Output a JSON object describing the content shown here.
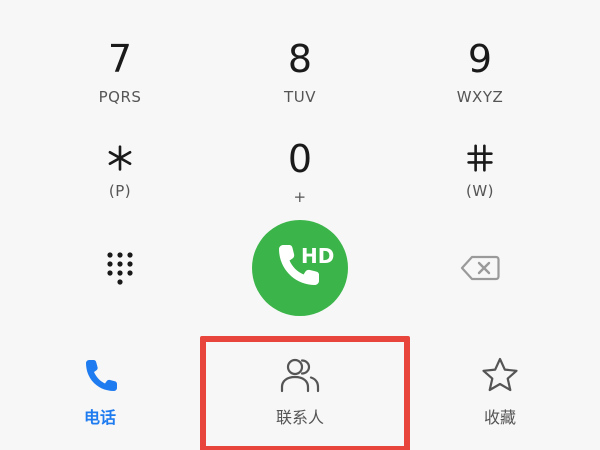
{
  "keypad": {
    "k7": {
      "digit": "7",
      "letters": "PQRS"
    },
    "k8": {
      "digit": "8",
      "letters": "TUV"
    },
    "k9": {
      "digit": "9",
      "letters": "WXYZ"
    },
    "kstar": {
      "letters": "(P)"
    },
    "k0": {
      "digit": "0",
      "letters": "+"
    },
    "khash": {
      "letters": "(W)"
    }
  },
  "call": {
    "badge": "HD",
    "color": "#3bb54a"
  },
  "tabs": {
    "phone": {
      "label": "电话",
      "icon": "phone-icon",
      "active": true
    },
    "contacts": {
      "label": "联系人",
      "icon": "contacts-icon"
    },
    "favorites": {
      "label": "收藏",
      "icon": "star-icon"
    }
  },
  "colors": {
    "accent": "#1f7cf0",
    "highlight": "#e8453c"
  }
}
